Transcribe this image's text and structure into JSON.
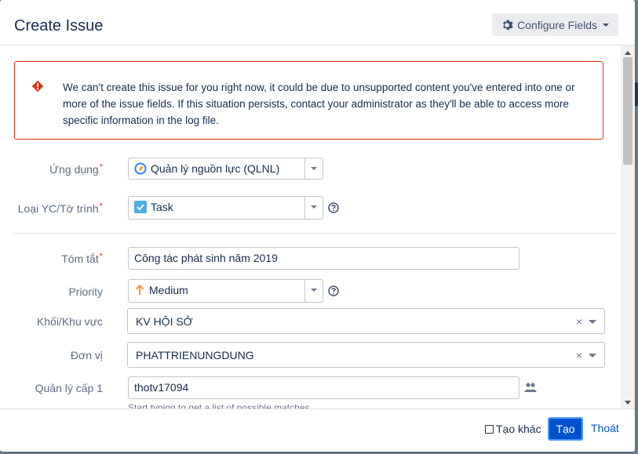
{
  "dialog": {
    "title": "Create Issue",
    "configure_label": "Configure Fields"
  },
  "error": {
    "message": "We can't create this issue for you right now, it could be due to unsupported content you've entered into one or more of the issue fields. If this situation persists, contact your administrator as they'll be able to access more specific information in the log file."
  },
  "fields": {
    "project": {
      "label": "Ứng dụng",
      "value": "Quản lý nguồn lực (QLNL)",
      "required": "*"
    },
    "issue_type": {
      "label": "Loại YC/Tờ trình",
      "value": "Task",
      "required": "*"
    },
    "summary": {
      "label": "Tóm tắt",
      "value": "Công tác phát sinh năm 2019",
      "required": "*"
    },
    "priority": {
      "label": "Priority",
      "value": "Medium"
    },
    "region": {
      "label": "Khối/Khu vực",
      "value": "KV HỘI SỞ",
      "clear": "×"
    },
    "unit": {
      "label": "Đơn vị",
      "value": "PHATTRIENUNGDUNG",
      "clear": "×"
    },
    "manager": {
      "label": "Quản lý cấp 1",
      "value": "thotv17094",
      "hint": "Start typing to get a list of possible matches."
    }
  },
  "footer": {
    "create_another_label": "Tạo khác",
    "submit_label": "Tạo",
    "cancel_label": "Thoát"
  },
  "colors": {
    "primary": "#0052cc",
    "error": "#de350b",
    "priority_medium": "#f79232",
    "task_icon": "#4bade8"
  }
}
